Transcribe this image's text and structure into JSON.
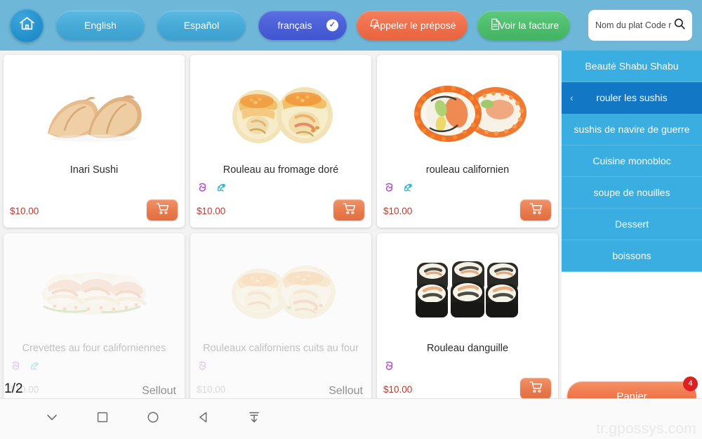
{
  "header": {
    "home_icon": "home-icon",
    "languages": [
      {
        "label": "English",
        "active": false
      },
      {
        "label": "Español",
        "active": false
      },
      {
        "label": "français",
        "active": true
      }
    ],
    "call_staff": {
      "label": "Appeler le préposé",
      "icon": "bell-icon",
      "color": "#ef6e4b"
    },
    "view_bill": {
      "label": "Voir la facture",
      "icon": "document-icon",
      "color": "#4dbd6c"
    },
    "search": {
      "placeholder": "Nom du plat Code r",
      "value": "",
      "icon": "search-icon"
    },
    "background_color": "#6fb7d8"
  },
  "menu": {
    "pager": "1/2",
    "items": [
      {
        "title": "Inari Sushi",
        "price": "$10.00",
        "tags": [],
        "sold_out": false,
        "sold_out_label": "",
        "image": "inari-sushi",
        "add_icon": "cart-icon"
      },
      {
        "title": "Rouleau au fromage doré",
        "price": "$10.00",
        "tags": [
          "shrimp-tag-icon",
          "fish-tag-icon"
        ],
        "sold_out": false,
        "sold_out_label": "",
        "image": "golden-cheese-roll",
        "add_icon": "cart-icon"
      },
      {
        "title": "rouleau californien",
        "price": "$10.00",
        "tags": [
          "shrimp-tag-icon",
          "fish-tag-icon"
        ],
        "sold_out": false,
        "sold_out_label": "",
        "image": "california-roll",
        "add_icon": "cart-icon"
      },
      {
        "title": "Crevettes au four californiennes",
        "price": "$10.00",
        "tags": [
          "shrimp-tag-icon",
          "fish-tag-icon"
        ],
        "sold_out": true,
        "sold_out_label": "Sellout",
        "image": "baked-california-shrimp",
        "add_icon": ""
      },
      {
        "title": "Rouleaux californiens cuits au four",
        "price": "$10.00",
        "tags": [
          "shrimp-tag-icon"
        ],
        "sold_out": true,
        "sold_out_label": "Sellout",
        "image": "baked-california-rolls",
        "add_icon": ""
      },
      {
        "title": "Rouleau danguille",
        "price": "$10.00",
        "tags": [
          "shrimp-tag-icon"
        ],
        "sold_out": false,
        "sold_out_label": "",
        "image": "eel-roll",
        "add_icon": "cart-icon"
      }
    ]
  },
  "sidebar": {
    "items": [
      {
        "label": "Beauté Shabu Shabu",
        "active": false
      },
      {
        "label": "rouler les sushis",
        "active": true
      },
      {
        "label": "sushis de navire de guerre",
        "active": false
      },
      {
        "label": "Cuisine monobloc",
        "active": false
      },
      {
        "label": "soupe de nouilles",
        "active": false
      },
      {
        "label": "Dessert",
        "active": false
      },
      {
        "label": "boissons",
        "active": false
      }
    ],
    "cart": {
      "label": "Panier",
      "badge": "4",
      "color": "#ef7348"
    }
  },
  "navbar": {
    "buttons": [
      {
        "icon": "chevron-down-icon"
      },
      {
        "icon": "square-icon"
      },
      {
        "icon": "circle-icon"
      },
      {
        "icon": "back-triangle-icon"
      },
      {
        "icon": "download-icon"
      }
    ]
  },
  "watermark": "tr.gpossys.com"
}
